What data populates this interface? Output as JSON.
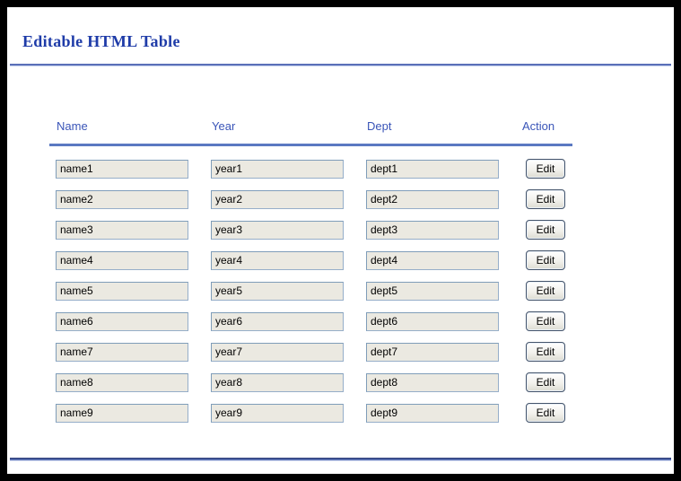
{
  "heading": "Editable HTML Table",
  "table": {
    "columns": [
      "Name",
      "Year",
      "Dept",
      "Action"
    ],
    "edit_label": "Edit",
    "rows": [
      {
        "name": "name1",
        "year": "year1",
        "dept": "dept1"
      },
      {
        "name": "name2",
        "year": "year2",
        "dept": "dept2"
      },
      {
        "name": "name3",
        "year": "year3",
        "dept": "dept3"
      },
      {
        "name": "name4",
        "year": "year4",
        "dept": "dept4"
      },
      {
        "name": "name5",
        "year": "year5",
        "dept": "dept5"
      },
      {
        "name": "name6",
        "year": "year6",
        "dept": "dept6"
      },
      {
        "name": "name7",
        "year": "year7",
        "dept": "dept7"
      },
      {
        "name": "name8",
        "year": "year8",
        "dept": "dept8"
      },
      {
        "name": "name9",
        "year": "year9",
        "dept": "dept9"
      }
    ]
  },
  "colors": {
    "heading_blue": "#1e3ba8",
    "header_text_blue": "#3a55b8",
    "rule_blue": "#5b79c2",
    "footer_rule_navy": "#24336e",
    "input_background": "#ebe9e1",
    "input_border": "#7f9db9",
    "frame_black": "#000000"
  }
}
